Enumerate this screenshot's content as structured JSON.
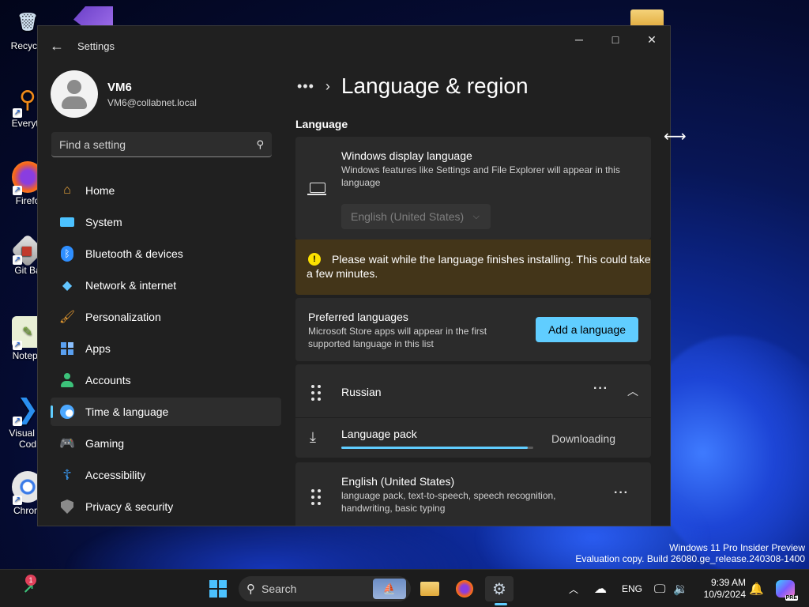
{
  "desktop": {
    "icons": [
      {
        "label": "Recycle",
        "icon": "recycle-bin-icon"
      },
      {
        "label": "Everyth",
        "icon": "everything-search-icon"
      },
      {
        "label": "Firefo",
        "icon": "firefox-icon"
      },
      {
        "label": "Git Ba",
        "icon": "git-bash-icon"
      },
      {
        "label": "Notepa",
        "icon": "notepad-plus-plus-icon"
      },
      {
        "label": "Visual St",
        "label2": "Cod",
        "icon": "vscode-icon"
      },
      {
        "label": "Chrom",
        "icon": "chrome-icon"
      }
    ],
    "watermark_line1": "Windows 11 Pro Insider Preview",
    "watermark_line2": "Evaluation copy. Build 26080.ge_release.240308-1400"
  },
  "window": {
    "title": "Settings",
    "back_glyph": "←",
    "minimize_glyph": "─",
    "maximize_glyph": "□",
    "close_glyph": "✕"
  },
  "profile": {
    "name": "VM6",
    "email": "VM6@collabnet.local"
  },
  "search": {
    "placeholder": "Find a setting"
  },
  "nav": {
    "items": [
      {
        "label": "Home",
        "icon": "home-icon",
        "color": "#e8a33a"
      },
      {
        "label": "System",
        "icon": "system-icon",
        "color": "#4cc2ff"
      },
      {
        "label": "Bluetooth & devices",
        "icon": "bluetooth-icon",
        "color": "#2f8fff"
      },
      {
        "label": "Network & internet",
        "icon": "network-icon",
        "color": "#63c5ff"
      },
      {
        "label": "Personalization",
        "icon": "brush-icon",
        "color": "#f0a030"
      },
      {
        "label": "Apps",
        "icon": "apps-icon",
        "color": "#5aa0f0"
      },
      {
        "label": "Accounts",
        "icon": "accounts-icon",
        "color": "#3cc27a"
      },
      {
        "label": "Time & language",
        "icon": "globe-clock-icon",
        "color": "#4ca8ff",
        "active": true
      },
      {
        "label": "Gaming",
        "icon": "gamepad-icon",
        "color": "#9a9a9a"
      },
      {
        "label": "Accessibility",
        "icon": "accessibility-icon",
        "color": "#3aa0ff"
      },
      {
        "label": "Privacy & security",
        "icon": "shield-icon",
        "color": "#8a8a8a"
      }
    ]
  },
  "page": {
    "breadcrumb_more": "•••",
    "breadcrumb_sep": "›",
    "title": "Language & region",
    "section_language": "Language",
    "display_language": {
      "title": "Windows display language",
      "description": "Windows features like Settings and File Explorer will appear in this language",
      "selected": "English (United States)"
    },
    "warning": {
      "text": "Please wait while the language finishes installing. This could take a few minutes.",
      "color": "#fce100"
    },
    "preferred": {
      "title": "Preferred languages",
      "description": "Microsoft Store apps will appear in the first supported language in this list",
      "add_button": "Add a language"
    },
    "languages": [
      {
        "name": "Russian",
        "expanded": true,
        "pack_label": "Language pack",
        "pack_status": "Downloading",
        "pack_progress": 0.97
      },
      {
        "name": "English (United States)",
        "features": "language pack, text-to-speech, speech recognition, handwriting, basic typing"
      }
    ]
  },
  "taskbar": {
    "widgets_badge": "1",
    "search_label": "Search",
    "tray": {
      "language": "ENG",
      "time": "9:39 AM",
      "date": "10/9/2024",
      "copilot_badge": "PRE"
    }
  },
  "accent": "#60cdff"
}
